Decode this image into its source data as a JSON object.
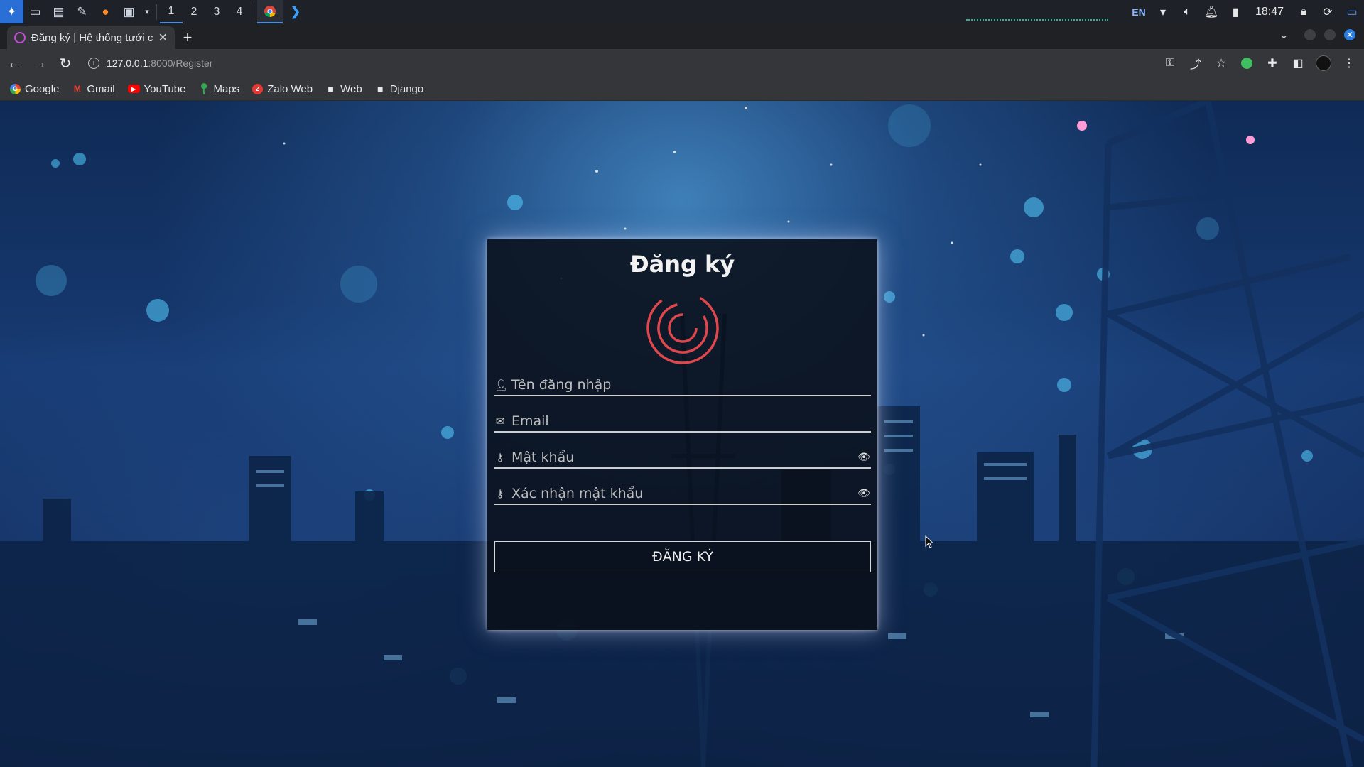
{
  "taskbar": {
    "workspaces": [
      "1",
      "2",
      "3",
      "4"
    ],
    "active_workspace": "1",
    "language": "EN",
    "clock": "18:47"
  },
  "browser": {
    "tab_title": "Đăng ký | Hệ thống tưới cả",
    "url_host": "127.0.0.1",
    "url_path": ":8000/Register",
    "bookmarks": [
      {
        "label": "Google",
        "icon": "google-icon"
      },
      {
        "label": "Gmail",
        "icon": "gmail-icon"
      },
      {
        "label": "YouTube",
        "icon": "youtube-icon"
      },
      {
        "label": "Maps",
        "icon": "maps-icon"
      },
      {
        "label": "Zalo Web",
        "icon": "zalo-icon"
      },
      {
        "label": "Web",
        "icon": "folder-icon"
      },
      {
        "label": "Django",
        "icon": "folder-icon"
      }
    ]
  },
  "page": {
    "title": "Đăng ký",
    "logo_color": "#e0474c",
    "fields": {
      "username_placeholder": "Tên đăng nhập",
      "email_placeholder": "Email",
      "password_placeholder": "Mật khẩu",
      "confirm_placeholder": "Xác nhận mật khẩu"
    },
    "submit_label": "ĐĂNG KÝ"
  }
}
